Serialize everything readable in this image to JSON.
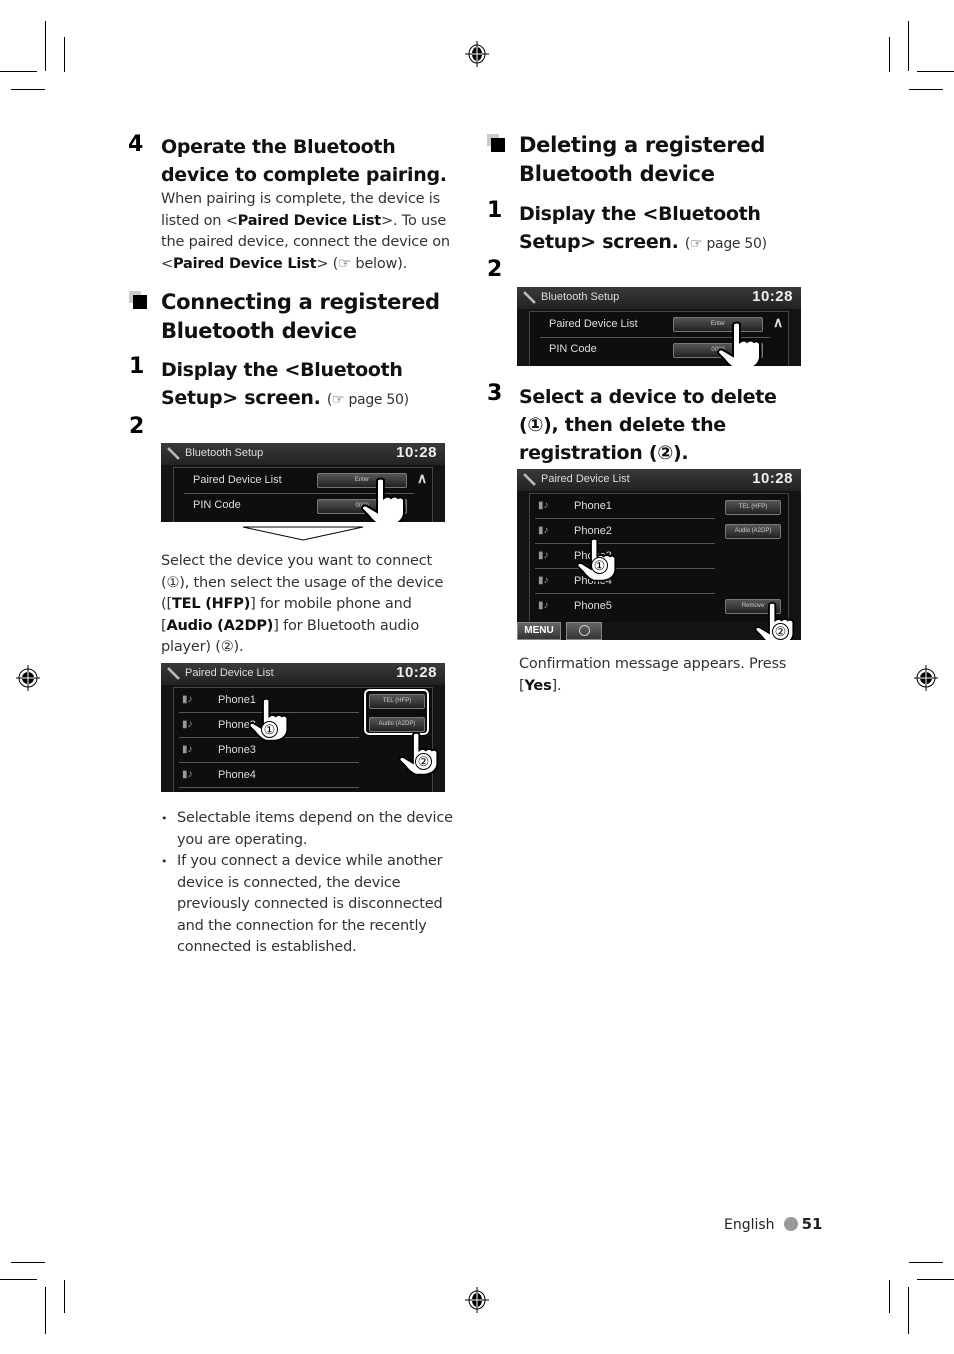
{
  "step4": {
    "number": "4",
    "title": "Operate the Bluetooth device to complete pairing.",
    "body_parts": [
      {
        "t": "When pairing is complete, the device is listed on <",
        "b": false
      },
      {
        "t": "Paired Device List",
        "b": true
      },
      {
        "t": ">. To use the paired device, connect the device on <",
        "b": false
      },
      {
        "t": "Paired Device List",
        "b": true
      },
      {
        "t": "> (☞ below).",
        "b": false
      }
    ]
  },
  "connect_section": {
    "heading": "Connecting a registered Bluetooth device",
    "step1": {
      "number": "1",
      "title": "Display the <Bluetooth Setup> screen.",
      "ref": "(☞ page 50)"
    },
    "step2": {
      "number": "2"
    },
    "instruction_parts": [
      {
        "t": "Select the device you want to connect (①), then select the usage of the device ([",
        "b": false
      },
      {
        "t": "TEL (HFP)",
        "b": true
      },
      {
        "t": "] for mobile phone and [",
        "b": false
      },
      {
        "t": "Audio (A2DP)",
        "b": true
      },
      {
        "t": "] for Bluetooth audio player) (②).",
        "b": false
      }
    ],
    "notes": [
      "Selectable items depend on the device you are operating.",
      "If you connect a device while another device is connected, the device previously connected is disconnected and the connection for the recently connected is established."
    ]
  },
  "delete_section": {
    "heading": "Deleting a registered Bluetooth device",
    "step1": {
      "number": "1",
      "title": "Display the <Bluetooth Setup> screen.",
      "ref": "(☞ page 50)"
    },
    "step2": {
      "number": "2"
    },
    "step3": {
      "number": "3",
      "title": "Select a device to delete (①), then delete the registration (②)."
    },
    "confirm_parts": [
      {
        "t": "Confirmation message appears. Press [",
        "b": false
      },
      {
        "t": "Yes",
        "b": true
      },
      {
        "t": "].",
        "b": false
      }
    ]
  },
  "screens": {
    "bt_setup": {
      "title": "Bluetooth Setup",
      "clock": "10:28",
      "rows": [
        {
          "label": "Paired Device List",
          "button": "Enter"
        },
        {
          "label": "PIN Code",
          "button": "0000"
        }
      ]
    },
    "paired_connect": {
      "title": "Paired Device List",
      "clock": "10:28",
      "devices": [
        "Phone1",
        "Phone2",
        "Phone3",
        "Phone4"
      ],
      "buttons": [
        "TEL (HFP)",
        "Audio (A2DP)"
      ]
    },
    "paired_delete": {
      "title": "Paired Device List",
      "clock": "10:28",
      "devices": [
        "Phone1",
        "Phone2",
        "Phone3",
        "Phone4",
        "Phone5"
      ],
      "buttons": [
        "TEL (HFP)",
        "Audio (A2DP)"
      ],
      "remove_button": "Remove",
      "menu_button": "MENU"
    },
    "callouts": {
      "one": "①",
      "two": "②"
    }
  },
  "footer": {
    "language": "English",
    "page": "51"
  }
}
